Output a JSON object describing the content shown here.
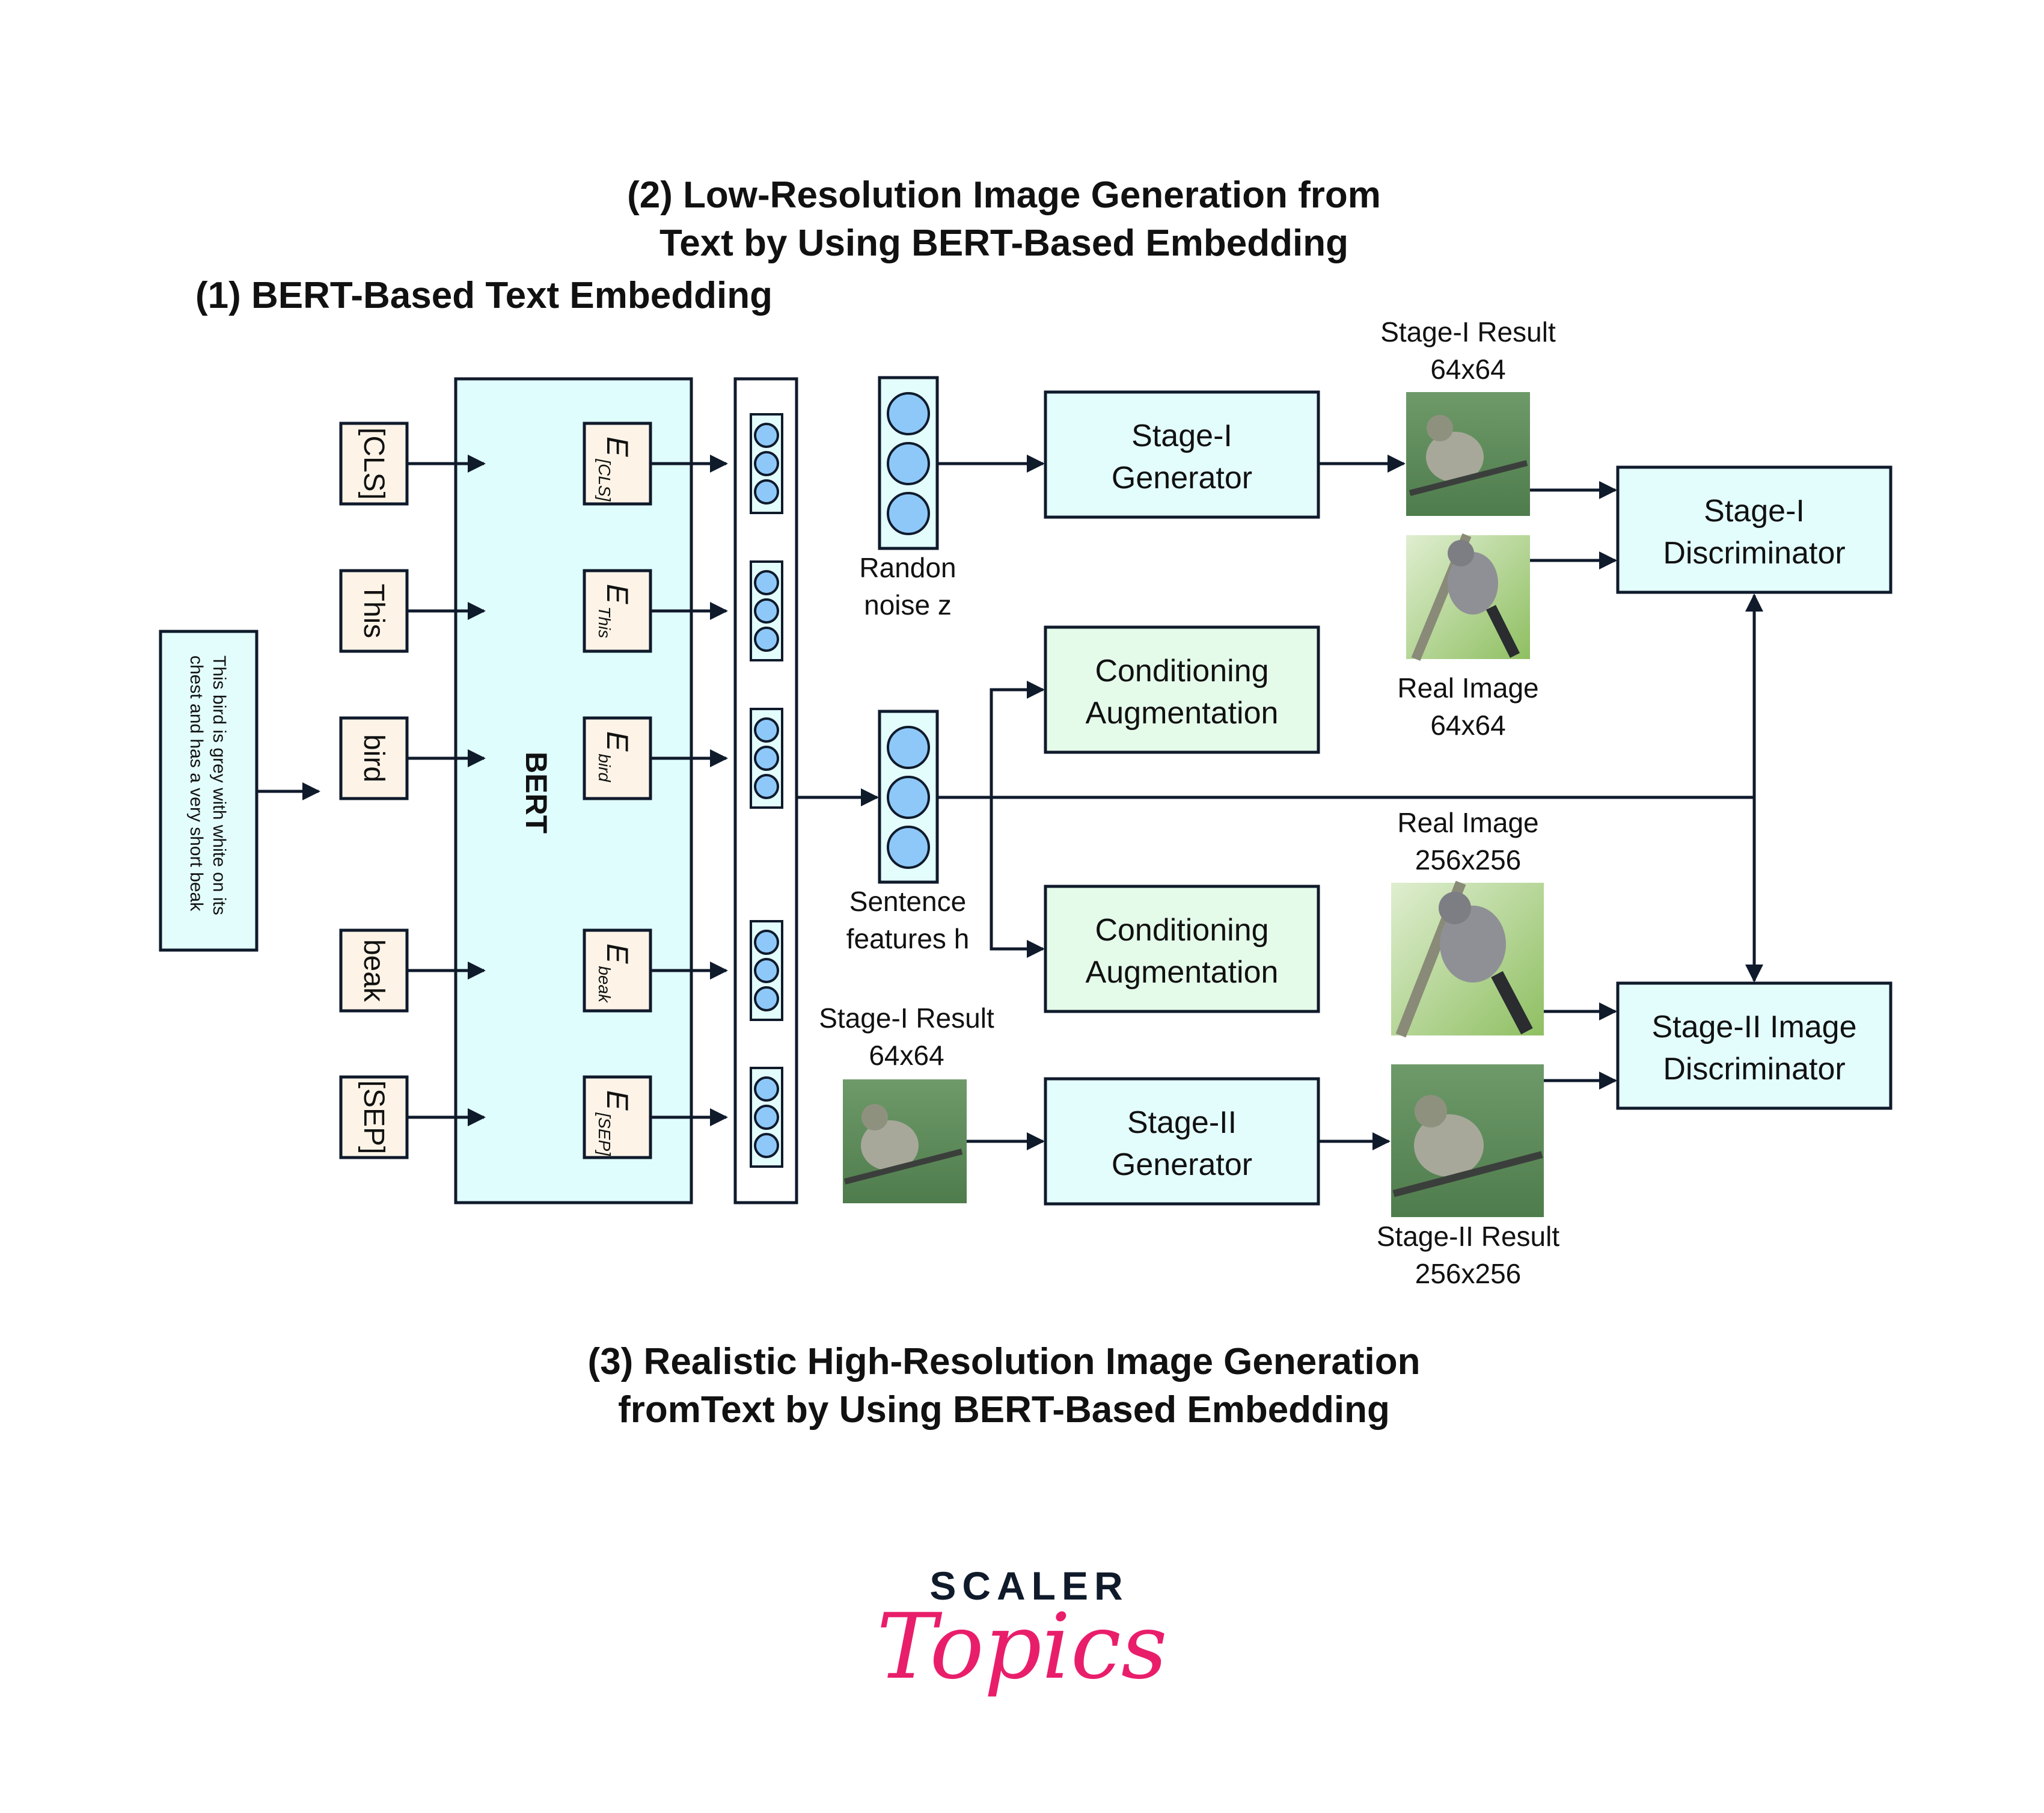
{
  "titles": {
    "section1": "(1) BERT-Based Text Embedding",
    "section2_line1": "(2) Low-Resolution Image Generation from",
    "section2_line2": "Text by Using BERT-Based Embedding",
    "section3_line1": "(3) Realistic High-Resolution Image Generation",
    "section3_line2": "fromText by Using BERT-Based Embedding"
  },
  "input_sentence": {
    "line1": "This bird is grey with white on its",
    "line2": "chest and has a very short beak"
  },
  "tokens": [
    "[CLS]",
    "This",
    "bird",
    "beak",
    "[SEP]"
  ],
  "bert_label": "BERT",
  "embeddings": [
    {
      "main": "E",
      "sub": "[CLS]"
    },
    {
      "main": "E",
      "sub": "This"
    },
    {
      "main": "E",
      "sub": "bird"
    },
    {
      "main": "E",
      "sub": "beak"
    },
    {
      "main": "E",
      "sub": "[SEP]"
    }
  ],
  "noise": {
    "line1": "Randon",
    "line2": "noise z"
  },
  "sentence_features": {
    "line1": "Sentence",
    "line2": "features h"
  },
  "blocks": {
    "stage1_generator": {
      "line1": "Stage-I",
      "line2": "Generator"
    },
    "cond_aug_top": {
      "line1": "Conditioning",
      "line2": "Augmentation"
    },
    "cond_aug_bottom": {
      "line1": "Conditioning",
      "line2": "Augmentation"
    },
    "stage2_generator": {
      "line1": "Stage-II",
      "line2": "Generator"
    },
    "stage1_discriminator": {
      "line1": "Stage-I",
      "line2": "Discriminator"
    },
    "stage2_discriminator": {
      "line1": "Stage-II Image",
      "line2": "Discriminator"
    }
  },
  "image_captions": {
    "stage1_result_top": {
      "line1": "Stage-I Result",
      "line2": "64x64"
    },
    "real_image_64": {
      "line1": "Real Image",
      "line2": "64x64"
    },
    "real_image_256": {
      "line1": "Real Image",
      "line2": "256x256"
    },
    "stage1_result_bottom": {
      "line1": "Stage-I Result",
      "line2": "64x64"
    },
    "stage2_result": {
      "line1": "Stage-II Result",
      "line2": "256x256"
    }
  },
  "logo": {
    "top": "SCALER",
    "bottom": "Topics"
  },
  "colors": {
    "stroke": "#0f1a2b",
    "bert_fill": "#e0fdfd",
    "token_fill": "#fdf4e7",
    "node_fill": "#8ec8f8",
    "block_fill": "#e3fdfd",
    "cond_fill": "#e5fbea",
    "logo_pink": "#e91e6b"
  }
}
